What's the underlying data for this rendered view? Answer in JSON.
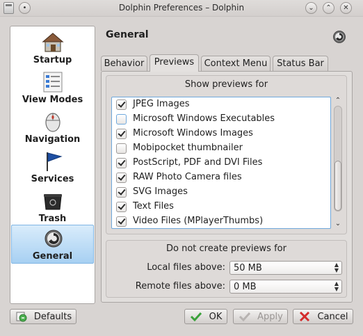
{
  "window": {
    "title": "Dolphin Preferences – Dolphin",
    "buttons": [
      "minimize",
      "maximize",
      "close"
    ]
  },
  "sidebar": {
    "items": [
      {
        "label": "Startup",
        "icon": "house-icon"
      },
      {
        "label": "View Modes",
        "icon": "view-modes-icon"
      },
      {
        "label": "Navigation",
        "icon": "mouse-icon"
      },
      {
        "label": "Services",
        "icon": "flag-icon"
      },
      {
        "label": "Trash",
        "icon": "trash-icon"
      },
      {
        "label": "General",
        "icon": "gear-icon",
        "active": true
      }
    ]
  },
  "header": {
    "title": "General",
    "icon": "gear-icon"
  },
  "tabs": [
    {
      "label": "Behavior",
      "active": false
    },
    {
      "label": "Previews",
      "active": true
    },
    {
      "label": "Context Menu",
      "active": false
    },
    {
      "label": "Status Bar",
      "active": false
    }
  ],
  "previews": {
    "show_title": "Show previews for",
    "items": [
      {
        "label": "JPEG Images",
        "checked": true
      },
      {
        "label": "Microsoft Windows Executables",
        "checked": false
      },
      {
        "label": "Microsoft Windows Images",
        "checked": true
      },
      {
        "label": "Mobipocket thumbnailer",
        "checked": false
      },
      {
        "label": "PostScript, PDF and DVI Files",
        "checked": true
      },
      {
        "label": "RAW Photo Camera files",
        "checked": true
      },
      {
        "label": "SVG Images",
        "checked": true
      },
      {
        "label": "Text Files",
        "checked": true
      },
      {
        "label": "Video Files (MPlayerThumbs)",
        "checked": true
      }
    ],
    "no_preview_title": "Do not create previews for",
    "local_label": "Local files above:",
    "local_value": "50 MB",
    "remote_label": "Remote files above:",
    "remote_value": "0 MB"
  },
  "buttons": {
    "defaults": "Defaults",
    "ok": "OK",
    "apply": "Apply",
    "cancel": "Cancel"
  },
  "colors": {
    "accent": "#a7d0f2",
    "list_border": "#6fa8dc",
    "ok_check": "#3aa13a",
    "cancel_x": "#d42a2a"
  }
}
